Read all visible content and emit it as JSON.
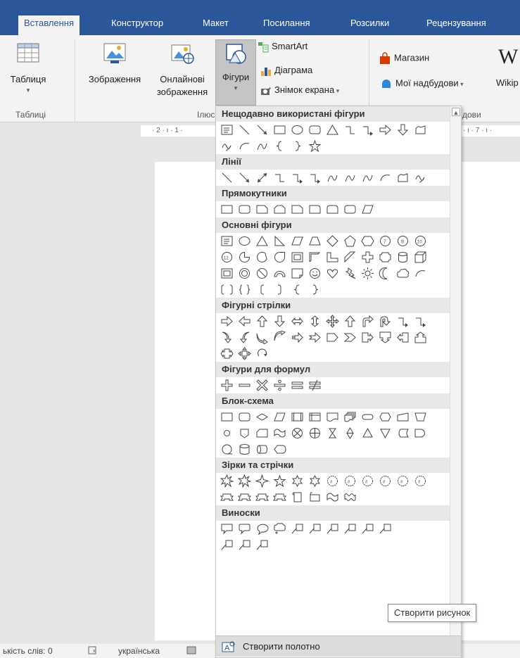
{
  "tabs": [
    "Вставлення",
    "Конструктор",
    "Макет",
    "Посилання",
    "Розсилки",
    "Рецензування"
  ],
  "ribbon": {
    "table_label": "Таблиця",
    "images_label": "Зображення",
    "online_images_label_1": "Онлайнові",
    "online_images_label_2": "зображення",
    "shapes_label": "Фігури",
    "smartart_label": "SmartArt",
    "chart_label": "Діаграма",
    "screenshot_label": "Знімок екрана",
    "store_label": "Магазин",
    "my_addins_label": "Мої надбудови",
    "wiki_label": "Wikip",
    "group_tables": "Таблиці",
    "group_illustrations": "Ілюс",
    "group_addins": "дови",
    "wiki_letter": "W"
  },
  "ruler": {
    "left": "· 2 · ı · 1 ·",
    "right": "· ı · 7 · ı ·"
  },
  "menu": {
    "categories": [
      {
        "title": "Нещодавно використані фігури"
      },
      {
        "title": "Лінії"
      },
      {
        "title": "Прямокутники"
      },
      {
        "title": "Основні фігури"
      },
      {
        "title": "Фігурні стрілки"
      },
      {
        "title": "Фігури для формул"
      },
      {
        "title": "Блок-схема"
      },
      {
        "title": "Зірки та стрічки"
      },
      {
        "title": "Виноски"
      }
    ],
    "new_canvas_label": "Створити полотно"
  },
  "tooltip": "Створити рисунок",
  "status": {
    "words": "ькість слів: 0",
    "language": "українська"
  },
  "colors": {
    "ribbon_blue": "#2b579a",
    "menu_category_bg": "#e8e8e8"
  }
}
